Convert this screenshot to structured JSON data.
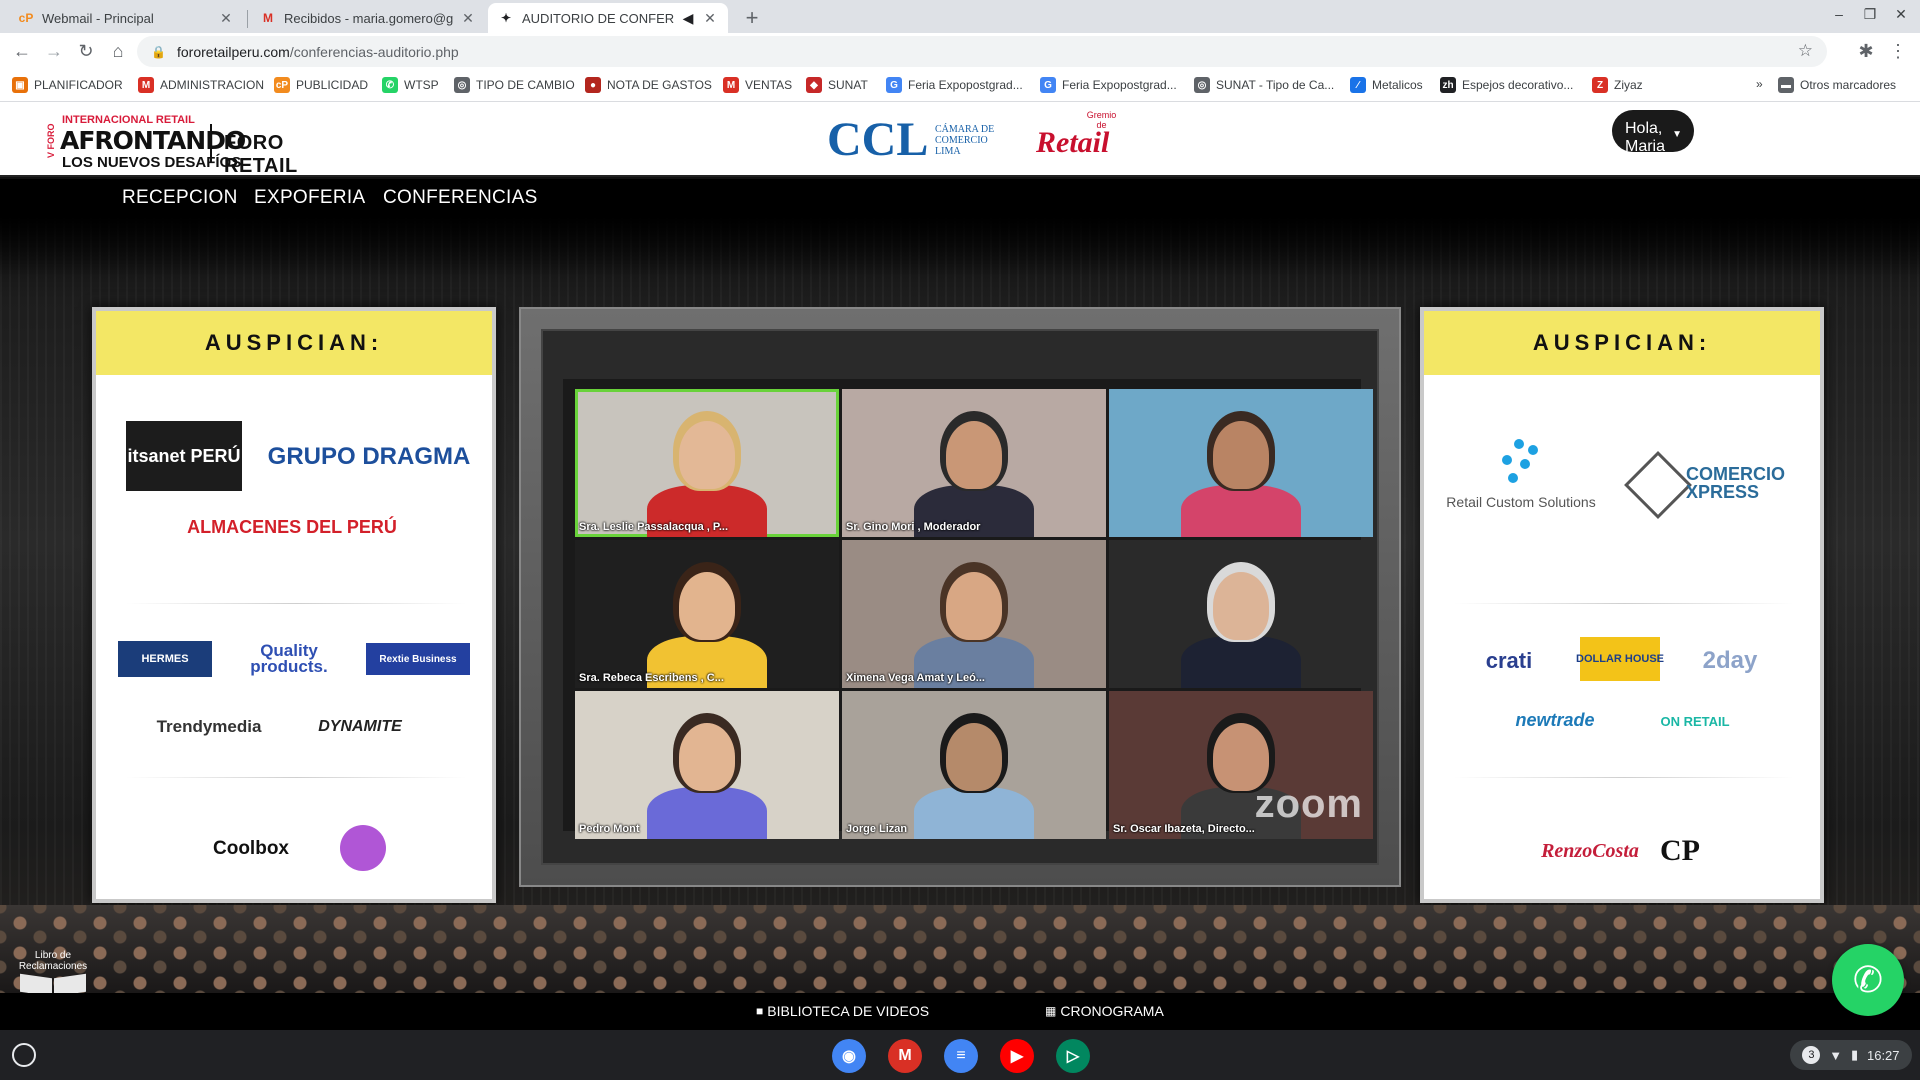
{
  "browser": {
    "tabs": [
      {
        "title": "Webmail - Principal",
        "favicon": "cp-logo-icon",
        "active": false
      },
      {
        "title": "Recibidos - maria.gomero@grupo",
        "favicon": "gmail-icon",
        "active": false
      },
      {
        "title": "AUDITORIO DE CONFERENCIAS",
        "favicon": "auditorium-icon",
        "active": true
      }
    ],
    "new_tab_label": "+",
    "url_host": "fororetailperu.com",
    "url_path": "/conferencias-auditorio.php"
  },
  "bookmarks": [
    {
      "label": "PLANIFICADOR",
      "icon": "planner-icon",
      "color": "#e8710a"
    },
    {
      "label": "ADMINISTRACION",
      "icon": "gmail-icon",
      "color": "#d93025"
    },
    {
      "label": "PUBLICIDAD",
      "icon": "cp-logo-icon",
      "color": "#f28b1e"
    },
    {
      "label": "WTSP",
      "icon": "whatsapp-icon",
      "color": "#25d366"
    },
    {
      "label": "TIPO DE CAMBIO",
      "icon": "globe-icon",
      "color": "#5f6368"
    },
    {
      "label": "NOTA DE GASTOS",
      "icon": "circle-logo-icon",
      "color": "#b3261e"
    },
    {
      "label": "VENTAS",
      "icon": "gmail-icon",
      "color": "#d93025"
    },
    {
      "label": "SUNAT",
      "icon": "sunat-icon",
      "color": "#c62828"
    },
    {
      "label": "Feria Expopostgrad...",
      "icon": "google-icon",
      "color": "#4285f4"
    },
    {
      "label": "Feria Expopostgrad...",
      "icon": "google-icon",
      "color": "#4285f4"
    },
    {
      "label": "SUNAT - Tipo de Ca...",
      "icon": "globe-icon",
      "color": "#5f6368"
    },
    {
      "label": "Metalicos",
      "icon": "brush-icon",
      "color": "#1a73e8"
    },
    {
      "label": "Espejos decorativo...",
      "icon": "zh-icon",
      "color": "#202124"
    },
    {
      "label": "Ziyaz",
      "icon": "ziyaz-icon",
      "color": "#d93025"
    }
  ],
  "bookmarks_more": "»",
  "bookmarks_other": "Otros marcadores",
  "site": {
    "logo_top": "INTERNACIONAL RETAIL",
    "logo_v": "V FORO",
    "logo_main": "AFRONTANDO",
    "logo_sub": "LOS NUEVOS DESAFÍOS",
    "logo_foro_retail": "FORO RETAIL",
    "ccl_abbr": "CCL",
    "ccl_name": "CÁMARA DE COMERCIO LIMA",
    "gremio_top": "Gremio de",
    "gremio_main": "Retail",
    "greeting": "Hola, Maria",
    "nav": [
      "RECEPCION",
      "EXPOFERIA",
      "CONFERENCIAS"
    ]
  },
  "sponsors_left": {
    "heading": "AUSPICIAN:",
    "logos": [
      "itsanet PERÚ",
      "GRUPO DRAGMA",
      "ALMACENES DEL PERÚ",
      "HERMES",
      "Quality products.",
      "Rextie Business",
      "Trendymedia",
      "DYNAMITE",
      "Coolbox"
    ]
  },
  "sponsors_right": {
    "heading": "AUSPICIAN:",
    "logos": [
      "Retail Custom Solutions",
      "COMERCIO XPRESS",
      "crati",
      "DOLLAR HOUSE",
      "2day",
      "newtrade",
      "ON RETAIL",
      "RenzoCosta",
      "CP"
    ]
  },
  "zoom": {
    "watermark": "zoom",
    "participants": [
      {
        "name": "Sra. Leslie Passalacqua , P...",
        "active": true,
        "bg": "#c8c4bd",
        "skin": "#e3b896",
        "shirt": "#cc2a2a",
        "hair": "#d8b470"
      },
      {
        "name": "Sr. Gino Mori , Moderador",
        "active": false,
        "bg": "#b8a9a3",
        "skin": "#c99776",
        "shirt": "#2b2b3a",
        "hair": "#2a2a2a"
      },
      {
        "name": "",
        "active": false,
        "bg": "#6ea8c8",
        "skin": "#b98464",
        "shirt": "#d4446a",
        "hair": "#3a2a22"
      },
      {
        "name": "Sra. Rebeca Escribens , C...",
        "active": false,
        "bg": "#1f1f1f",
        "skin": "#e2b48e",
        "shirt": "#f1c232",
        "hair": "#3a2418"
      },
      {
        "name": "Ximena Vega Amat y Leó...",
        "active": false,
        "bg": "#9a8c84",
        "skin": "#d8a784",
        "shirt": "#6a7fa0",
        "hair": "#4a3426"
      },
      {
        "name": "",
        "active": false,
        "bg": "#2a2a2a",
        "skin": "#dcb497",
        "shirt": "#1d2233",
        "hair": "#d9d9d9"
      },
      {
        "name": "Pedro Mont",
        "active": false,
        "bg": "#d7d2c8",
        "skin": "#e2b592",
        "shirt": "#6a6ad8",
        "hair": "#3a2a22"
      },
      {
        "name": "Jorge Lizan",
        "active": false,
        "bg": "#a9a29a",
        "skin": "#b58a6a",
        "shirt": "#8fb4d6",
        "hair": "#1a1a1a"
      },
      {
        "name": "Sr. Oscar Ibazeta, Directo...",
        "active": false,
        "bg": "#5a3a36",
        "skin": "#c79274",
        "shirt": "#3a3a3a",
        "hair": "#1a1a1a"
      }
    ]
  },
  "libro": "Libro de Reclamaciones",
  "bottom_links": {
    "biblioteca": "BIBLIOTECA DE VIDEOS",
    "cronograma": "CRONOGRAMA"
  },
  "shelf": {
    "apps": [
      {
        "name": "chrome-icon",
        "color": "#4285f4"
      },
      {
        "name": "gmail-icon",
        "color": "#d93025"
      },
      {
        "name": "docs-icon",
        "color": "#4285f4"
      },
      {
        "name": "youtube-icon",
        "color": "#ff0000"
      },
      {
        "name": "play-store-icon",
        "color": "#01875f"
      }
    ],
    "notification_count": "3",
    "time": "16:27"
  }
}
